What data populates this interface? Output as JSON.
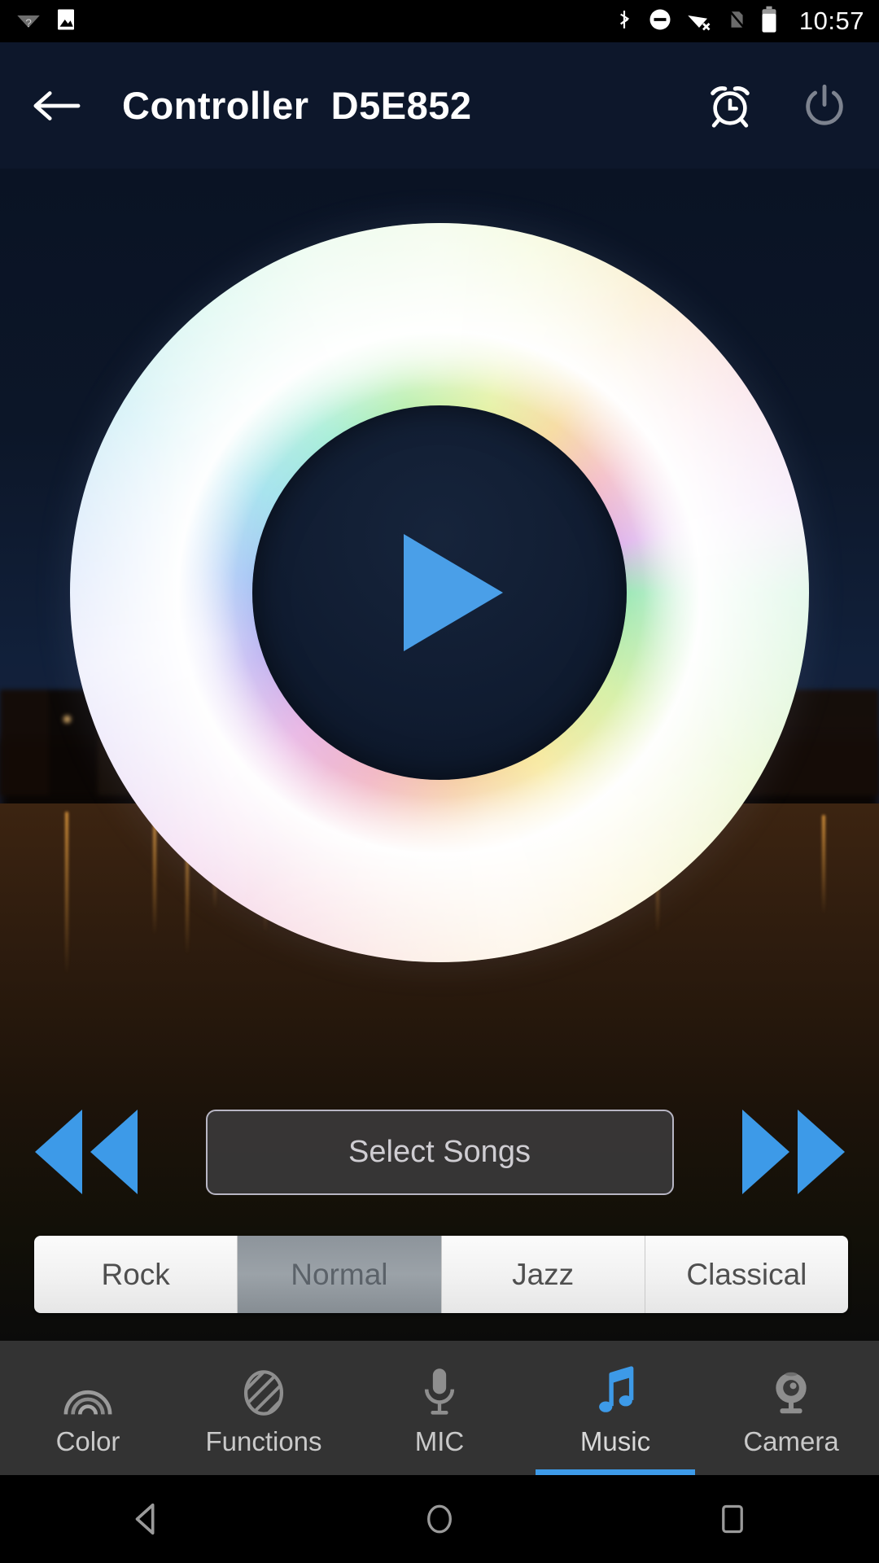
{
  "status_bar": {
    "time": "10:57",
    "left_icons": [
      "wifi-question-icon",
      "image-icon"
    ],
    "right_icons": [
      "bluetooth-icon",
      "do-not-disturb-icon",
      "wifi-off-icon",
      "sim-off-icon",
      "battery-icon"
    ]
  },
  "header": {
    "back_icon": "back-arrow-icon",
    "title": "Controller  D5E852",
    "alarm_icon": "alarm-clock-icon",
    "power_icon": "power-icon"
  },
  "wheel": {
    "play_icon": "play-icon",
    "accent": "#4a9fe8"
  },
  "transport": {
    "prev_label": "previous-track",
    "next_label": "next-track",
    "select_songs_label": "Select Songs",
    "arrow_color": "#3d9ae8"
  },
  "equalizer": {
    "selected": "Normal",
    "modes": [
      {
        "label": "Rock",
        "active": false
      },
      {
        "label": "Normal",
        "active": true
      },
      {
        "label": "Jazz",
        "active": false
      },
      {
        "label": "Classical",
        "active": false
      }
    ]
  },
  "bottom_nav": {
    "active": "Music",
    "active_color": "#3d9ae8",
    "items": [
      {
        "label": "Color",
        "icon": "rainbow-icon",
        "active": false
      },
      {
        "label": "Functions",
        "icon": "striped-circle-icon",
        "active": false
      },
      {
        "label": "MIC",
        "icon": "microphone-icon",
        "active": false
      },
      {
        "label": "Music",
        "icon": "music-note-icon",
        "active": true
      },
      {
        "label": "Camera",
        "icon": "webcam-icon",
        "active": false
      }
    ]
  },
  "system_nav": {
    "back_icon": "android-back-icon",
    "home_icon": "android-home-icon",
    "recents_icon": "android-recents-icon"
  }
}
